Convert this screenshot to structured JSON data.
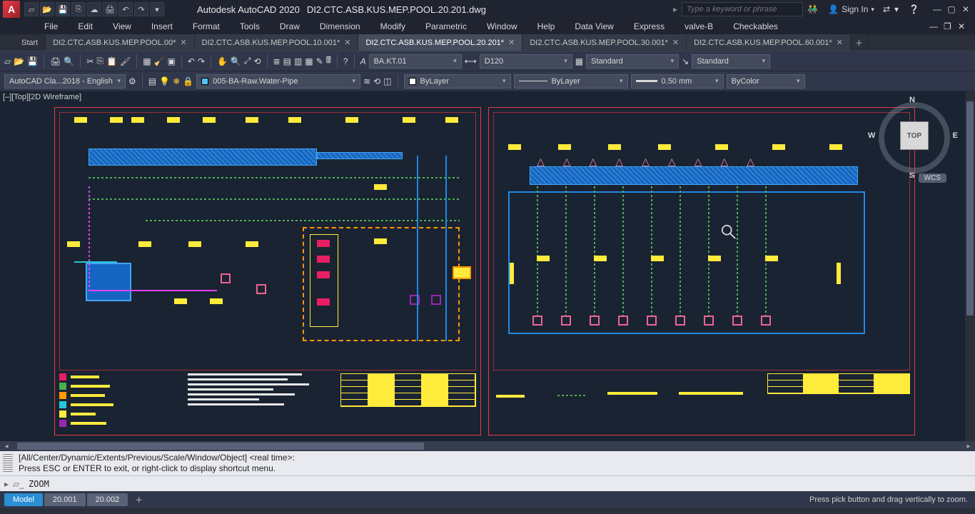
{
  "title": {
    "app": "Autodesk AutoCAD 2020",
    "doc": "DI2.CTC.ASB.KUS.MEP.POOL.20.201.dwg",
    "search_placeholder": "Type a keyword or phrase",
    "signin": "Sign In"
  },
  "menu": [
    "File",
    "Edit",
    "View",
    "Insert",
    "Format",
    "Tools",
    "Draw",
    "Dimension",
    "Modify",
    "Parametric",
    "Window",
    "Help",
    "Data View",
    "Express",
    "valve-B",
    "Checkables"
  ],
  "tabs": [
    {
      "label": "Start",
      "active": false,
      "start": true
    },
    {
      "label": "DI2.CTC.ASB.KUS.MEP.POOL.00*",
      "active": false
    },
    {
      "label": "DI2.CTC.ASB.KUS.MEP.POOL.10.001*",
      "active": false
    },
    {
      "label": "DI2.CTC.ASB.KUS.MEP.POOL.20.201*",
      "active": true
    },
    {
      "label": "DI2.CTC.ASB.KUS.MEP.POOL.30.001*",
      "active": false
    },
    {
      "label": "DI2.CTC.ASB.KUS.MEP.POOL.60.001*",
      "active": false
    }
  ],
  "toolbar1": {
    "text_style": "BA.KT.01",
    "dim_style": "D120",
    "table_style": "Standard",
    "mleader_style": "Standard"
  },
  "toolbar2": {
    "workspace": "AutoCAD Cla...2018 - English",
    "layer": "005-BA-Raw.Water-Pipe",
    "color": "ByLayer",
    "linetype": "ByLayer",
    "lineweight": "0.50 mm",
    "plotstyle": "ByColor"
  },
  "viewport": {
    "label": "[–][Top][2D Wireframe]",
    "cube_face": "TOP",
    "dirs": {
      "n": "N",
      "e": "E",
      "s": "S",
      "w": "W"
    },
    "wcs": "WCS"
  },
  "command": {
    "history1": "[All/Center/Dynamic/Extents/Previous/Scale/Window/Object] <real time>:",
    "history2": "Press ESC or ENTER to exit, or right-click to display shortcut menu.",
    "input": "ZOOM"
  },
  "status": {
    "model": "Model",
    "layouts": [
      "20.001",
      "20.002"
    ],
    "hint": "Press pick button and drag vertically to zoom."
  }
}
